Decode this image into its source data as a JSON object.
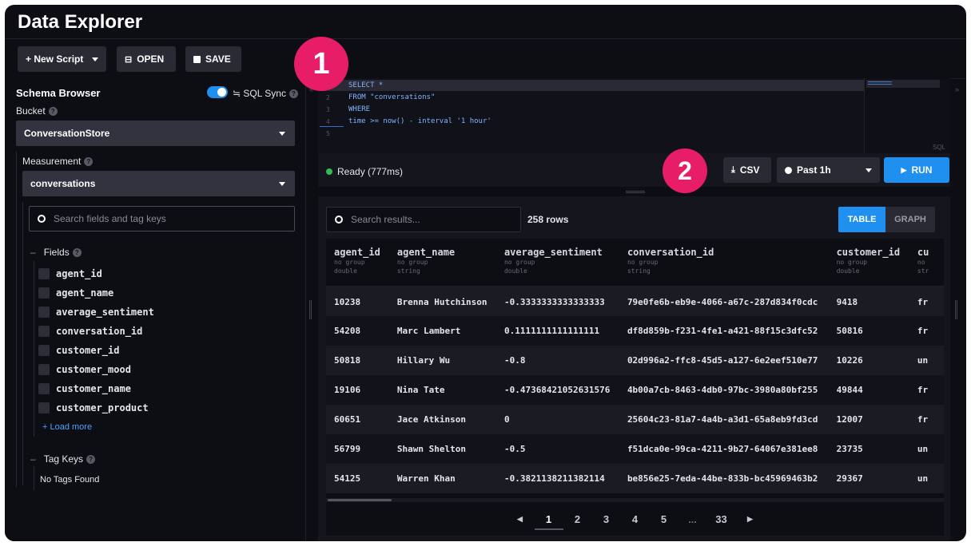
{
  "header": {
    "title": "Data Explorer"
  },
  "toolbar": {
    "new_script": "+ New Script",
    "open": "OPEN",
    "save": "SAVE"
  },
  "sidebar": {
    "title": "Schema Browser",
    "sql_sync": "≒ SQL Sync",
    "bucket_label": "Bucket",
    "bucket_value": "ConversationStore",
    "measurement_label": "Measurement",
    "measurement_value": "conversations",
    "search_placeholder": "Search fields and tag keys",
    "fields_label": "Fields",
    "fields": [
      "agent_id",
      "agent_name",
      "average_sentiment",
      "conversation_id",
      "customer_id",
      "customer_mood",
      "customer_name",
      "customer_product"
    ],
    "load_more": "+ Load more",
    "tag_keys_label": "Tag Keys",
    "no_tags": "No Tags Found"
  },
  "editor": {
    "lines": [
      {
        "num": "1",
        "text": "SELECT *"
      },
      {
        "num": "2",
        "text": "FROM \"conversations\""
      },
      {
        "num": "3",
        "text": "WHERE"
      },
      {
        "num": "4",
        "text": "time >= now() - interval '1 hour'"
      },
      {
        "num": "5",
        "text": ""
      }
    ],
    "mode_label": "SQL"
  },
  "status": {
    "text": "Ready (777ms)",
    "csv": "CSV",
    "time_range": "Past 1h",
    "run": "RUN"
  },
  "results": {
    "search_placeholder": "Search results...",
    "row_count": "258 rows",
    "view_table": "TABLE",
    "view_graph": "GRAPH",
    "columns": [
      {
        "name": "agent_id",
        "group": "no group",
        "type": "double"
      },
      {
        "name": "agent_name",
        "group": "no group",
        "type": "string"
      },
      {
        "name": "average_sentiment",
        "group": "no group",
        "type": "double"
      },
      {
        "name": "conversation_id",
        "group": "no group",
        "type": "string"
      },
      {
        "name": "customer_id",
        "group": "no group",
        "type": "double"
      },
      {
        "name": "cu",
        "group": "no",
        "type": "str"
      }
    ],
    "rows": [
      [
        "10238",
        "Brenna Hutchinson",
        "-0.3333333333333333",
        "79e0fe6b-eb9e-4066-a67c-287d834f0cdc",
        "9418",
        "fr"
      ],
      [
        "54208",
        "Marc Lambert",
        "0.1111111111111111",
        "df8d859b-f231-4fe1-a421-88f15c3dfc52",
        "50816",
        "fr"
      ],
      [
        "50818",
        "Hillary Wu",
        "-0.8",
        "02d996a2-ffc8-45d5-a127-6e2eef510e77",
        "10226",
        "un"
      ],
      [
        "19106",
        "Nina Tate",
        "-0.47368421052631576",
        "4b00a7cb-8463-4db0-97bc-3980a80bf255",
        "49844",
        "fr"
      ],
      [
        "60651",
        "Jace Atkinson",
        "0",
        "25604c23-81a7-4a4b-a3d1-65a8eb9fd3cd",
        "12007",
        "fr"
      ],
      [
        "56799",
        "Shawn Shelton",
        "-0.5",
        "f51dca0e-99ca-4211-9b27-64067e381ee8",
        "23735",
        "un"
      ],
      [
        "54125",
        "Warren Khan",
        "-0.3821138211382114",
        "be856e25-7eda-44be-833b-bc45969463b2",
        "29367",
        "un"
      ]
    ],
    "pages": [
      "1",
      "2",
      "3",
      "4",
      "5",
      "...",
      "33"
    ],
    "current_page": "1"
  },
  "annotations": {
    "badge1": "1",
    "badge2": "2"
  },
  "colors": {
    "accent_blue": "#1f8ff0",
    "ready_green": "#34bb55",
    "badge_pink": "#e81d68",
    "sql_keyword": "#5aa8ff"
  }
}
